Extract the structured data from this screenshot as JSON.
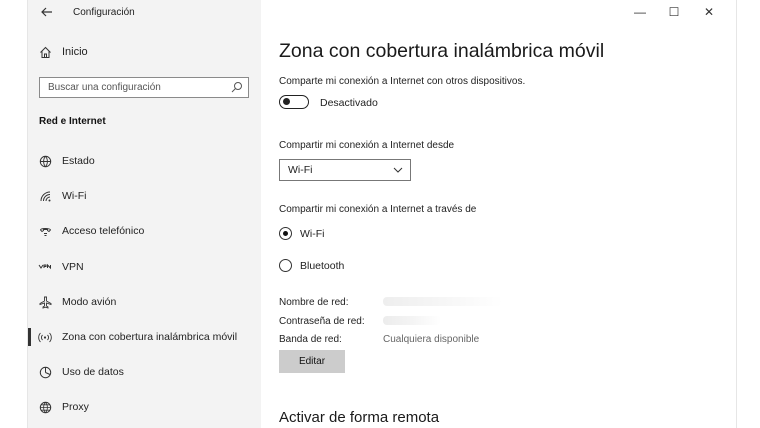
{
  "window": {
    "app_title": "Configuración",
    "controls": {
      "minimize": "—",
      "maximize": "☐",
      "close": "✕"
    }
  },
  "sidebar": {
    "home_label": "Inicio",
    "search_placeholder": "Buscar una configuración",
    "section_title": "Red e Internet",
    "items": [
      {
        "label": "Estado",
        "icon": "globe-network-icon"
      },
      {
        "label": "Wi-Fi",
        "icon": "wifi-icon"
      },
      {
        "label": "Acceso telefónico",
        "icon": "dial-up-phone-icon"
      },
      {
        "label": "VPN",
        "icon": "vpn-icon"
      },
      {
        "label": "Modo avión",
        "icon": "airplane-icon"
      },
      {
        "label": "Zona con cobertura inalámbrica móvil",
        "icon": "mobile-hotspot-icon",
        "active": true
      },
      {
        "label": "Uso de datos",
        "icon": "data-usage-icon"
      },
      {
        "label": "Proxy",
        "icon": "globe-icon"
      }
    ]
  },
  "main": {
    "title": "Zona con cobertura inalámbrica móvil",
    "share_description": "Comparte mi conexión a Internet con otros dispositivos.",
    "toggle": {
      "state_label": "Desactivado",
      "on": false
    },
    "share_from": {
      "label": "Compartir mi conexión a Internet desde",
      "selected": "Wi-Fi"
    },
    "share_over": {
      "label": "Compartir mi conexión a Internet a través de",
      "options": [
        {
          "label": "Wi-Fi",
          "checked": true
        },
        {
          "label": "Bluetooth",
          "checked": false
        }
      ]
    },
    "network": {
      "name_label": "Nombre de red:",
      "password_label": "Contraseña de red:",
      "band_label": "Banda de red:",
      "band_value": "Cualquiera disponible"
    },
    "edit_button": "Editar",
    "remote_title": "Activar de forma remota"
  }
}
